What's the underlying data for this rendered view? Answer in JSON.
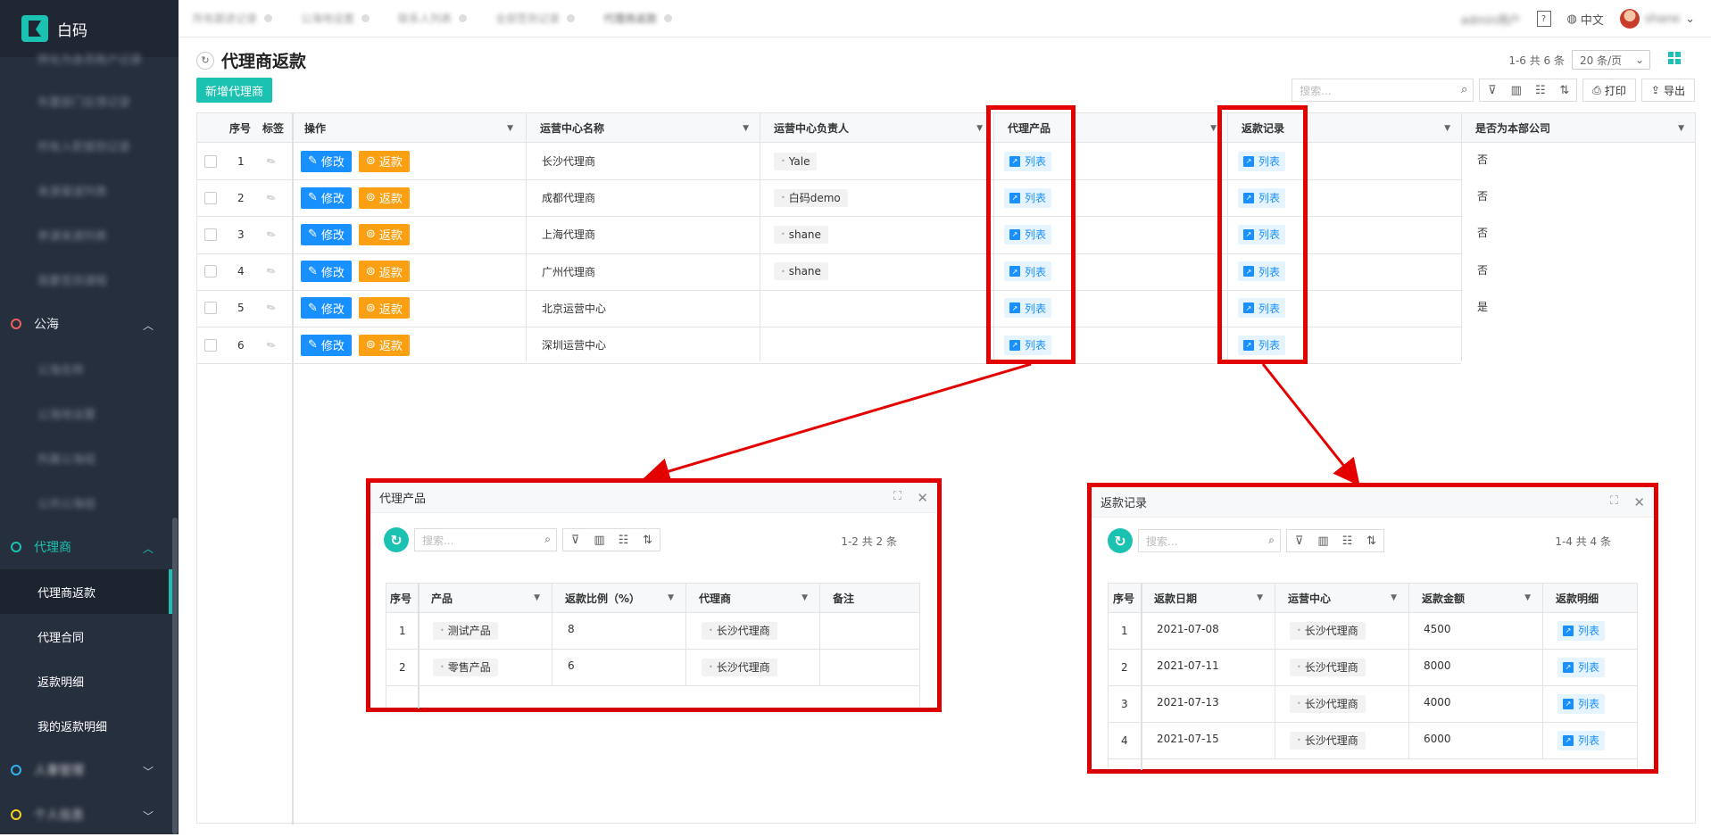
{
  "app": {
    "name": "白码"
  },
  "sidebar": {
    "blurred_items": [
      "转化为会员账户记录",
      "布置部门反馈记录",
      "所有入职报到记录",
      "来源渠道列表",
      "参课来源列表",
      "我要签到课程"
    ],
    "group_public": {
      "label": "公海",
      "items_blurred": [
        "公海名称",
        "公海地设置",
        "所属公海组",
        "公共公海组"
      ]
    },
    "group_agent": {
      "label": "代理商",
      "items": [
        "代理商返款",
        "代理合同",
        "返款明细",
        "我的返款明细"
      ]
    },
    "group_hr": {
      "label": "人事管理"
    },
    "group_personal": {
      "label": "个人信息"
    }
  },
  "topbar": {
    "tabs": [
      "所有跟进记录",
      "公海地设置",
      "联系人列表",
      "全部签到记录",
      "代理商返款"
    ],
    "username_blurred": "admin用户",
    "language": "中文",
    "user_blurred": "shane"
  },
  "page": {
    "title": "代理商返款",
    "pager": "1-6 共 6 条",
    "page_size": "20 条/页",
    "add_button": "新增代理商",
    "search_placeholder": "搜索...",
    "print": "打印",
    "export": "导出"
  },
  "table": {
    "headers": {
      "index": "序号",
      "tag": "标签",
      "action": "操作",
      "center": "运营中心名称",
      "owner": "运营中心负责人",
      "product": "代理产品",
      "refund": "返款记录",
      "own_company": "是否为本部公司"
    },
    "edit_label": "修改",
    "refund_label": "返款",
    "list_label": "列表",
    "rows": [
      {
        "index": "1",
        "center": "长沙代理商",
        "owner": "Yale",
        "own": "否"
      },
      {
        "index": "2",
        "center": "成都代理商",
        "owner": "白码demo",
        "own": "否"
      },
      {
        "index": "3",
        "center": "上海代理商",
        "owner": "shane",
        "own": "否"
      },
      {
        "index": "4",
        "center": "广州代理商",
        "owner": "shane",
        "own": "否"
      },
      {
        "index": "5",
        "center": "北京运营中心",
        "owner": "",
        "own": "是"
      },
      {
        "index": "6",
        "center": "深圳运营中心",
        "owner": "",
        "own": ""
      }
    ]
  },
  "modal_product": {
    "title": "代理产品",
    "search_placeholder": "搜索...",
    "count": "1-2 共 2 条",
    "headers": [
      "序号",
      "产品",
      "返款比例（%）",
      "代理商",
      "备注"
    ],
    "rows": [
      {
        "index": "1",
        "product": "测试产品",
        "ratio": "8",
        "agent": "长沙代理商",
        "note": ""
      },
      {
        "index": "2",
        "product": "零售产品",
        "ratio": "6",
        "agent": "长沙代理商",
        "note": ""
      }
    ]
  },
  "modal_refund": {
    "title": "返款记录",
    "search_placeholder": "搜索...",
    "count": "1-4 共 4 条",
    "headers": [
      "序号",
      "返款日期",
      "运营中心",
      "返款金额",
      "返款明细"
    ],
    "list_label": "列表",
    "rows": [
      {
        "index": "1",
        "date": "2021-07-08",
        "center": "长沙代理商",
        "amount": "4500"
      },
      {
        "index": "2",
        "date": "2021-07-11",
        "center": "长沙代理商",
        "amount": "8000"
      },
      {
        "index": "3",
        "date": "2021-07-13",
        "center": "长沙代理商",
        "amount": "4000"
      },
      {
        "index": "4",
        "date": "2021-07-15",
        "center": "长沙代理商",
        "amount": "6000"
      }
    ]
  },
  "colors": {
    "accent": "#1cc2b1",
    "edit": "#1890ff",
    "refund": "#faa012",
    "highlight": "#e50000",
    "sidebar": "#262f3e"
  }
}
